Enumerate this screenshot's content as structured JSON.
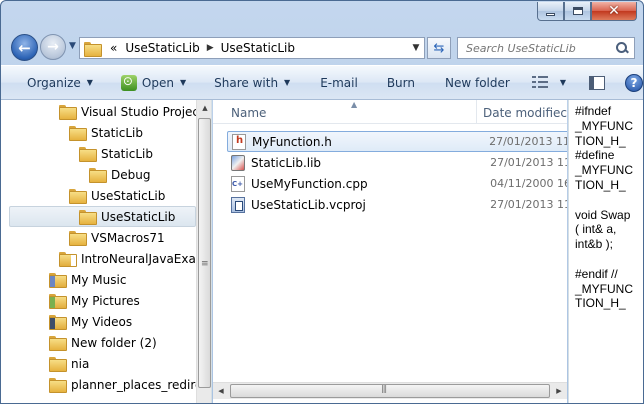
{
  "address": {
    "crumbs": [
      "UseStaticLib",
      "UseStaticLib"
    ],
    "overflow": "«"
  },
  "search": {
    "placeholder": "Search UseStaticLib"
  },
  "toolbar": {
    "organize": "Organize",
    "open": "Open",
    "share_with": "Share with",
    "email": "E-mail",
    "burn": "Burn",
    "new_folder": "New folder"
  },
  "nav_tree": [
    {
      "label": "Visual Studio Projects",
      "icon": "folder-icon"
    },
    {
      "label": "StaticLib",
      "icon": "folder-icon"
    },
    {
      "label": "StaticLib",
      "icon": "folder-icon"
    },
    {
      "label": "Debug",
      "icon": "folder-icon"
    },
    {
      "label": "UseStaticLib",
      "icon": "folder-icon"
    },
    {
      "label": "UseStaticLib",
      "icon": "folder-icon",
      "selected": true
    },
    {
      "label": "VSMacros71",
      "icon": "folder-icon"
    },
    {
      "label": "IntroNeuralJavaExamp",
      "icon": "document-folder-icon"
    },
    {
      "label": "My Music",
      "icon": "music-folder-icon"
    },
    {
      "label": "My Pictures",
      "icon": "pictures-folder-icon"
    },
    {
      "label": "My Videos",
      "icon": "videos-folder-icon"
    },
    {
      "label": "New folder (2)",
      "icon": "folder-icon"
    },
    {
      "label": "nia",
      "icon": "folder-icon"
    },
    {
      "label": "planner_places_redirect.",
      "icon": "folder-icon"
    }
  ],
  "columns": {
    "name": "Name",
    "date": "Date modifiec"
  },
  "files": [
    {
      "name": "MyFunction.h",
      "date": "27/01/2013 11",
      "icon": "header-file-icon",
      "selected": true
    },
    {
      "name": "StaticLib.lib",
      "date": "27/01/2013 11",
      "icon": "library-file-icon"
    },
    {
      "name": "UseMyFunction.cpp",
      "date": "04/11/2000 16",
      "icon": "cpp-file-icon"
    },
    {
      "name": "UseStaticLib.vcproj",
      "date": "27/01/2013 11",
      "icon": "vcproj-file-icon"
    }
  ],
  "preview": {
    "lines": [
      "#ifndef",
      "_MYFUNC",
      "TION_H_",
      "#define",
      "_MYFUNC",
      "TION_H_",
      "",
      "void Swap",
      "( int& a,",
      "int&b );",
      "",
      "#endif //",
      "_MYFUNC",
      "TION_H_"
    ]
  },
  "colors": {
    "selection_border": "#84acdd",
    "chrome": "#b2c9e5",
    "close_button": "#c2391f"
  }
}
